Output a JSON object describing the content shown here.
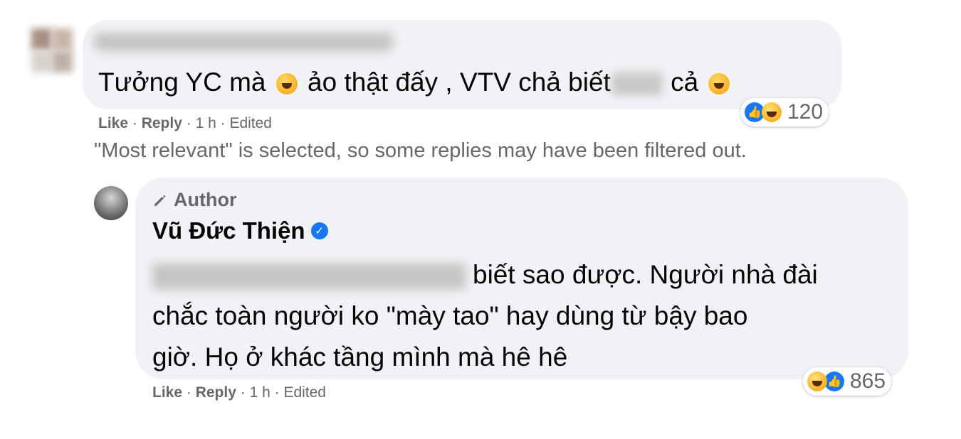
{
  "comment": {
    "text_before": "Tưởng YC mà",
    "text_middle": "ảo thật đấy , VTV chả biết",
    "text_after": "cả",
    "emoji_icon": "laughing-face-icon",
    "meta": {
      "like": "Like",
      "reply": "Reply",
      "time": "1 h",
      "edited": "Edited"
    },
    "reactions": {
      "icons": [
        "like-icon",
        "haha-icon"
      ],
      "count": "120"
    }
  },
  "filter_note": "\"Most relevant\" is selected, so some replies may have been filtered out.",
  "reply": {
    "author_badge": "Author",
    "author_name": "Vũ Đức Thiện",
    "text_line1_after_blur": "biết sao được. Người nhà đài",
    "text_line2": "chắc toàn người ko \"mày tao\" hay dùng từ bậy bao",
    "text_line3": "giờ. Họ ở khác tầng mình mà hê hê",
    "meta": {
      "like": "Like",
      "reply": "Reply",
      "time": "1 h",
      "edited": "Edited"
    },
    "reactions": {
      "icons": [
        "haha-icon",
        "like-icon"
      ],
      "count": "865"
    }
  },
  "colors": {
    "bubble": "#f0f2f5",
    "meta_text": "#65676b",
    "accent_blue": "#1877f2"
  }
}
